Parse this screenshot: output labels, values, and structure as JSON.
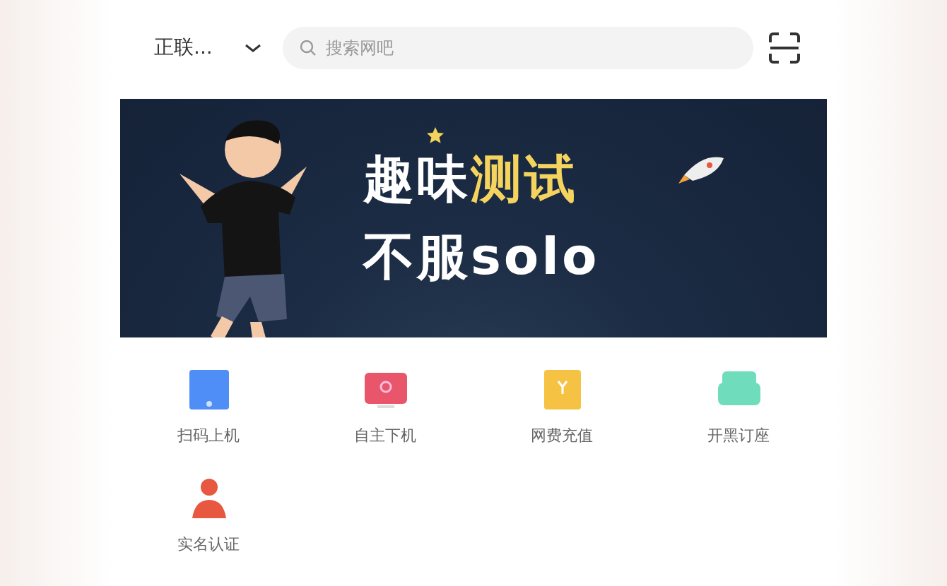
{
  "top_bar": {
    "location": "正联...",
    "search": {
      "placeholder": "搜索网吧"
    }
  },
  "banner": {
    "line_1": [
      {
        "text": "趣味",
        "highlight": false
      },
      {
        "text": "测试",
        "highlight": true
      }
    ],
    "line_2": "不服solo"
  },
  "shortcuts": [
    {
      "label": "扫码上机",
      "color": "#4f8ef7",
      "kind": "screen"
    },
    {
      "label": "自主下机",
      "color": "#e9566b",
      "kind": "monitor"
    },
    {
      "label": "网费充值",
      "color": "#f5c244",
      "kind": "wallet"
    },
    {
      "label": "开黑订座",
      "color": "#6fdcbc",
      "kind": "sofa"
    },
    {
      "label": "实名认证",
      "color": "#e8573f",
      "kind": "person"
    }
  ]
}
